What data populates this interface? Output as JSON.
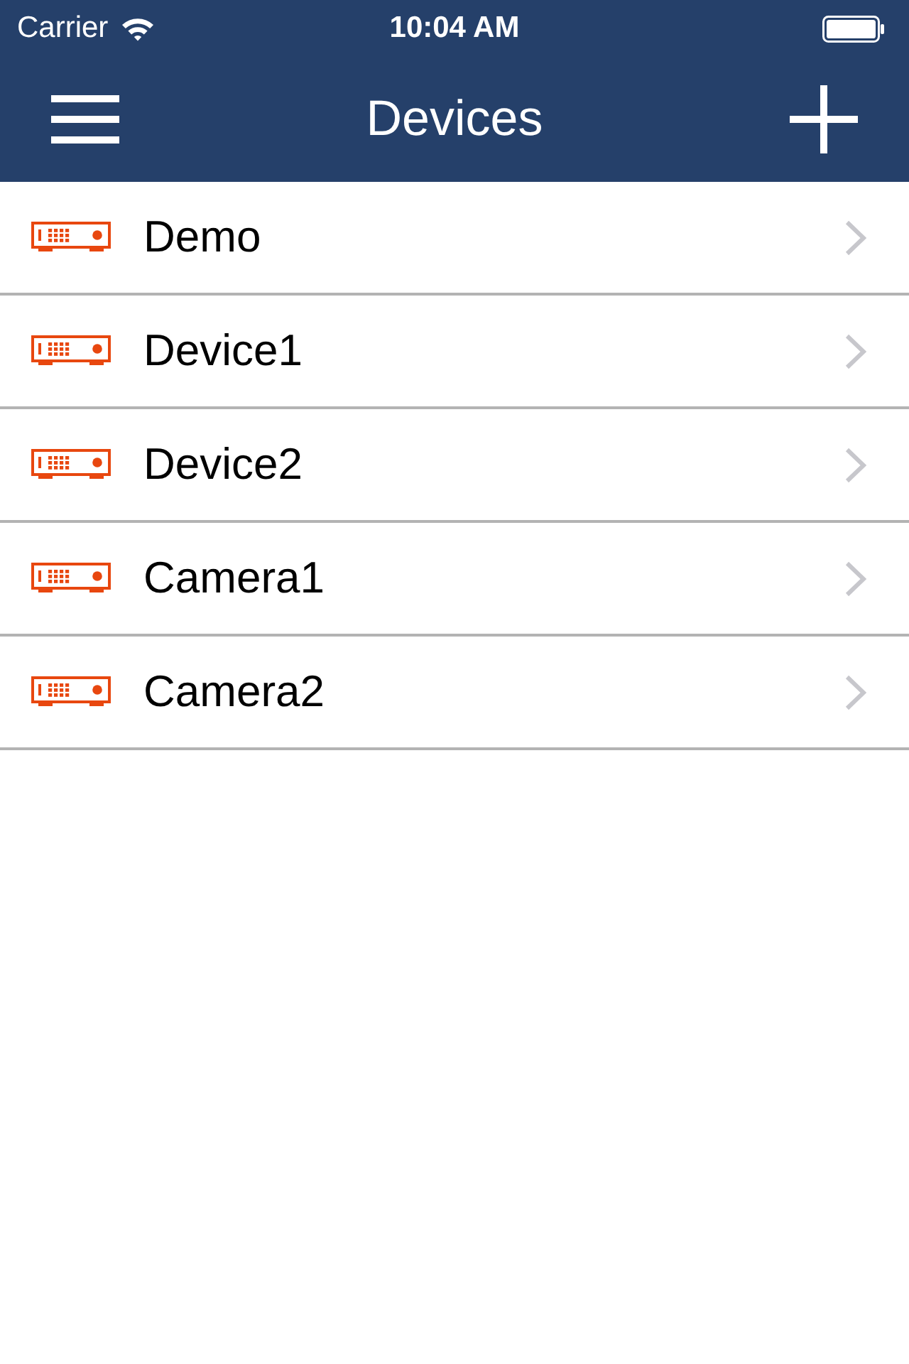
{
  "status_bar": {
    "carrier": "Carrier",
    "time": "10:04 AM"
  },
  "nav_bar": {
    "title": "Devices"
  },
  "devices": [
    {
      "name": "Demo"
    },
    {
      "name": "Device1"
    },
    {
      "name": "Device2"
    },
    {
      "name": "Camera1"
    },
    {
      "name": "Camera2"
    }
  ]
}
